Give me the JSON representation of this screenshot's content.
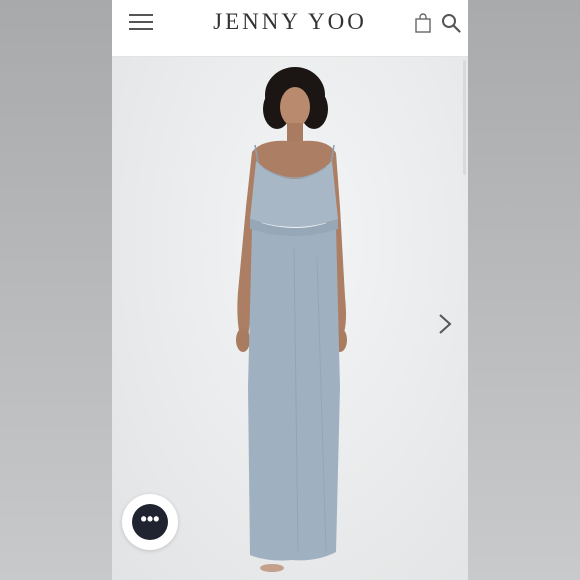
{
  "header": {
    "brand": "JENNY YOO",
    "icons": [
      "hamburger-menu-icon",
      "shopping-bag-icon",
      "search-icon"
    ]
  },
  "product_image": {
    "alt": "",
    "dress_color": "#9fb0c0",
    "background_color": "#eceeef"
  },
  "carousel": {
    "next_icon": "chevron-right-icon"
  },
  "floating_button": {
    "label": "•••",
    "icon": "more-dots-icon"
  }
}
